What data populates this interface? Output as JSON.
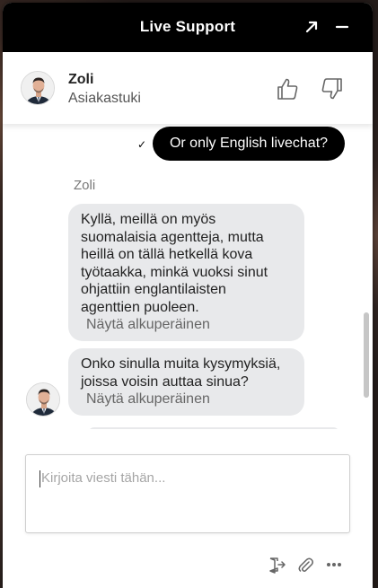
{
  "header": {
    "title": "Live Support"
  },
  "agent": {
    "name": "Zoli",
    "role": "Asiakastuki"
  },
  "messages": {
    "user_text": "Or only English livechat?",
    "sender_name": "Zoli",
    "bubble1": {
      "lines": [
        "Kyllä, meillä on myös",
        "suomalaisia agentteja, mutta",
        "heillä on tällä hetkellä kova",
        "työtaakka, minkä vuoksi sinut",
        "ohjattiin englantilaisten",
        "agenttien puoleen."
      ],
      "original_link": "Näytä alkuperäinen"
    },
    "bubble2": {
      "lines": [
        "Onko sinulla muita kysymyksiä,",
        "joissa voisin auttaa sinua?"
      ],
      "original_link": "Näytä alkuperäinen"
    }
  },
  "composer": {
    "placeholder": "Kirjoita viesti tähän..."
  },
  "icons": {
    "expand": "expand-arrow-icon",
    "minimize": "minimize-icon",
    "thumbs_up": "thumbs-up-icon",
    "thumbs_down": "thumbs-down-icon",
    "exit": "exit-chat-icon",
    "attach": "paperclip-icon",
    "more": "more-options-icon"
  },
  "colors": {
    "header_bg": "#000000",
    "user_bubble": "#000000",
    "agent_bubble": "#e8e9eb"
  }
}
